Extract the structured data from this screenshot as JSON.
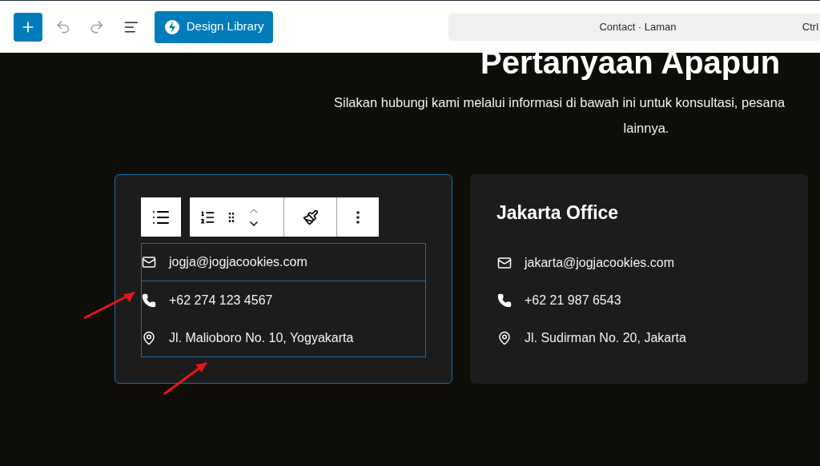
{
  "top_bar": {
    "design_library": "Design Library",
    "document_title": "Contact · Laman",
    "shortcut": "Ctrl"
  },
  "hero": {
    "heading": "Pertanyaan Apapun",
    "lines": [
      "Silakan hubungi kami melalui informasi di bawah ini untuk konsultasi, pesana",
      "lainnya."
    ]
  },
  "offices": [
    {
      "selected": true,
      "items": [
        {
          "kind": "email",
          "text": "jogja@jogjacookies.com"
        },
        {
          "kind": "phone",
          "text": "+62 274 123 4567"
        },
        {
          "kind": "address",
          "text": "Jl. Malioboro No. 10, Yogyakarta"
        }
      ]
    },
    {
      "title": "Jakarta Office",
      "selected": false,
      "items": [
        {
          "kind": "email",
          "text": "jakarta@jogjacookies.com"
        },
        {
          "kind": "phone",
          "text": "+62 21 987 6543"
        },
        {
          "kind": "address",
          "text": "Jl. Sudirman No. 20, Jakarta"
        }
      ]
    }
  ]
}
